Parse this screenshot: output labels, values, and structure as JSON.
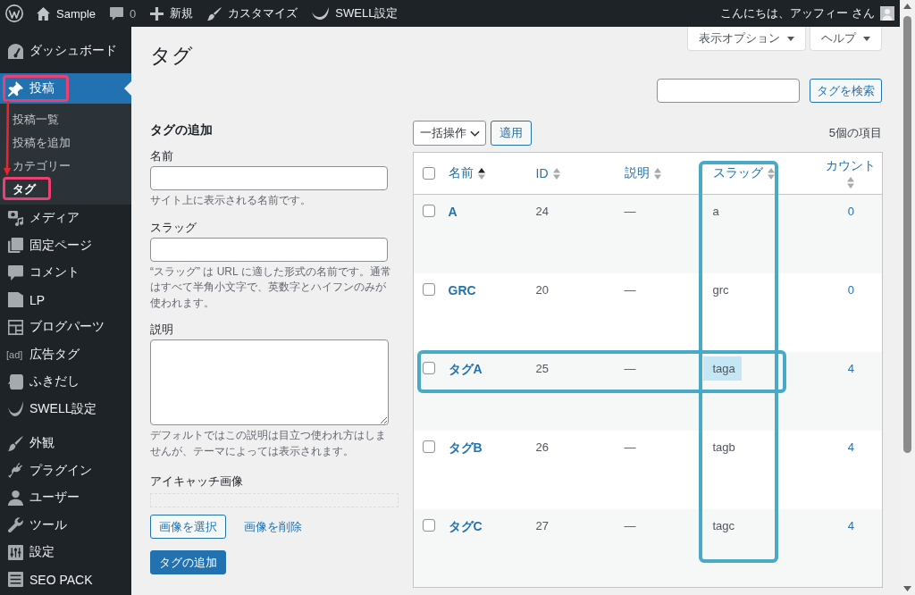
{
  "admin_bar": {
    "items": [
      {
        "label": "Sample"
      },
      {
        "label": "0"
      },
      {
        "label": "新規"
      },
      {
        "label": "カスタマイズ"
      },
      {
        "label": "SWELL設定"
      }
    ],
    "greeting": "こんにちは、アッフィー さん"
  },
  "sidebar": {
    "groups": [
      {
        "items": [
          {
            "label": "ダッシュボード",
            "selected": false,
            "annotated": false
          }
        ]
      },
      {
        "items": [
          {
            "label": "投稿",
            "selected": true,
            "annotated": true,
            "children": [
              {
                "label": "投稿一覧",
                "selected": false,
                "annotated": false
              },
              {
                "label": "投稿を追加",
                "selected": false,
                "annotated": false
              },
              {
                "label": "カテゴリー",
                "selected": false,
                "annotated": false
              },
              {
                "label": "タグ",
                "selected": true,
                "annotated": true
              }
            ]
          },
          {
            "label": "メディア",
            "selected": false,
            "annotated": false
          },
          {
            "label": "固定ページ",
            "selected": false,
            "annotated": false
          },
          {
            "label": "コメント",
            "selected": false,
            "annotated": false
          },
          {
            "label": "LP",
            "selected": false,
            "annotated": false
          },
          {
            "label": "ブログパーツ",
            "selected": false,
            "annotated": false
          },
          {
            "label": "広告タグ",
            "icon_text": "[ad]",
            "selected": false,
            "annotated": false
          },
          {
            "label": "ふきだし",
            "selected": false,
            "annotated": false
          },
          {
            "label": "SWELL設定",
            "selected": false,
            "annotated": false
          }
        ]
      },
      {
        "items": [
          {
            "label": "外観",
            "selected": false,
            "annotated": false
          },
          {
            "label": "プラグイン",
            "selected": false,
            "annotated": false
          },
          {
            "label": "ユーザー",
            "selected": false,
            "annotated": false
          },
          {
            "label": "ツール",
            "selected": false,
            "annotated": false
          },
          {
            "label": "設定",
            "selected": false,
            "annotated": false
          },
          {
            "label": "SEO PACK",
            "selected": false,
            "annotated": false
          }
        ]
      }
    ]
  },
  "page": {
    "title": "タグ",
    "screen_options": [
      "表示オプション",
      "ヘルプ"
    ],
    "search_button": "タグを検索"
  },
  "add_form": {
    "title": "タグの追加",
    "fields": [
      {
        "kind": "input",
        "label": "名前",
        "hint": "サイト上に表示される名前です。"
      },
      {
        "kind": "input",
        "label": "スラッグ",
        "hint": "“スラッグ” は URL に適した形式の名前です。通常はすべて半角小文字で、英数字とハイフンのみが使われます。"
      },
      {
        "kind": "textarea",
        "label": "説明",
        "hint": "デフォルトではこの説明は目立つ使われ方はしませんが、テーマによっては表示されます。"
      },
      {
        "kind": "image",
        "label": "アイキャッチ画像",
        "select_button": "画像を選択",
        "remove_link": "画像を削除"
      }
    ],
    "submit": "タグの追加"
  },
  "tag_list": {
    "bulk_action": "一括操作",
    "apply": "適用",
    "item_count": "5個の項目",
    "select_all_checked": false,
    "columns": [
      {
        "label": "名前",
        "sorted": true,
        "annotated": false
      },
      {
        "label": "ID",
        "sorted": false,
        "annotated": false
      },
      {
        "label": "説明",
        "sorted": false,
        "annotated": false
      },
      {
        "label": "スラッグ",
        "sorted": false,
        "annotated": true
      },
      {
        "label": "カウント",
        "sorted": false,
        "annotated": false
      }
    ],
    "rows": [
      {
        "checked": false,
        "annotated": false,
        "name": "A",
        "id": "24",
        "description": "—",
        "slug": "a",
        "slug_highlighted": false,
        "count": "0"
      },
      {
        "checked": false,
        "annotated": false,
        "name": "GRC",
        "id": "20",
        "description": "—",
        "slug": "grc",
        "slug_highlighted": false,
        "count": "0"
      },
      {
        "checked": false,
        "annotated": true,
        "name": "タグA",
        "id": "25",
        "description": "—",
        "slug": "taga",
        "slug_highlighted": true,
        "count": "4"
      },
      {
        "checked": false,
        "annotated": false,
        "name": "タグB",
        "id": "26",
        "description": "—",
        "slug": "tagb",
        "slug_highlighted": false,
        "count": "4"
      },
      {
        "checked": false,
        "annotated": false,
        "name": "タグC",
        "id": "27",
        "description": "—",
        "slug": "tagc",
        "slug_highlighted": false,
        "count": "4"
      }
    ]
  }
}
